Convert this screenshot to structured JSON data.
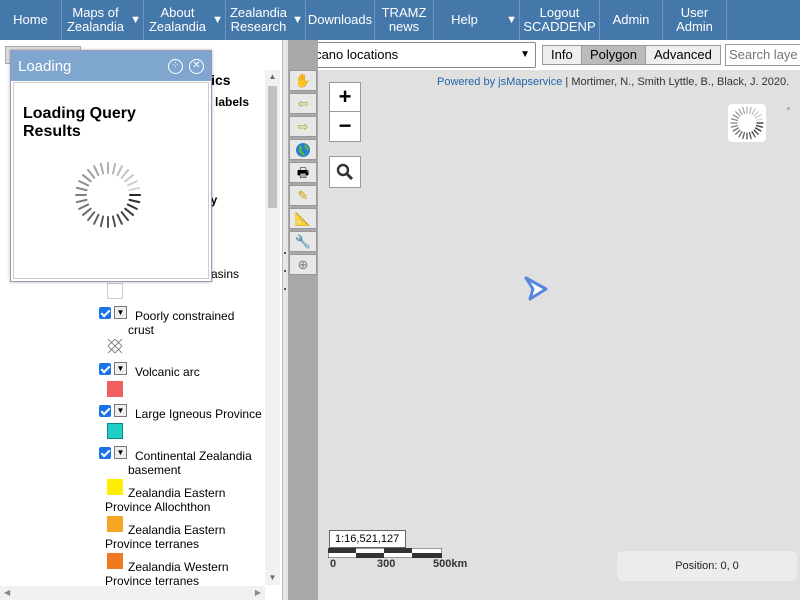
{
  "menu": {
    "items": [
      {
        "label": "Home",
        "dropdown": false
      },
      {
        "label": "Maps of Zealandia",
        "dropdown": true
      },
      {
        "label": "About Zealandia",
        "dropdown": true
      },
      {
        "label": "Zealandia Research",
        "dropdown": true
      },
      {
        "label": "Downloads",
        "dropdown": false
      },
      {
        "label": "TRAMZ news",
        "dropdown": false
      },
      {
        "label": "Help",
        "dropdown": true
      },
      {
        "label": "Logout SCADDENP",
        "dropdown": false
      },
      {
        "label": "Admin",
        "dropdown": false
      },
      {
        "label": "User Admin",
        "dropdown": false
      }
    ]
  },
  "loading_dialog": {
    "header": "Loading",
    "title": "Loading Query Results"
  },
  "layers": {
    "partial_header": "onics",
    "partial_labels": "labels",
    "partial_ogy": "ogy",
    "partial_slash": "/",
    "partial_basins": "asins",
    "items": [
      {
        "label": "Poorly constrained crust",
        "checked": true
      },
      {
        "label": "Volcanic arc",
        "checked": true,
        "color": "#f06060"
      },
      {
        "label": "Large Igneous Province",
        "checked": true,
        "color": "#1fcfc7"
      },
      {
        "label": "Continental Zealandia basement",
        "checked": true
      }
    ],
    "sublegend": [
      {
        "label": "Zealandia Eastern Province Allochthon",
        "color": "#ffee00"
      },
      {
        "label": "Zealandia Eastern Province terranes",
        "color": "#f5a623"
      },
      {
        "label": "Zealandia Western Province terranes",
        "color": "#f07a20"
      }
    ]
  },
  "map": {
    "layer_select": "Volcano locations",
    "tabs": [
      "Info",
      "Polygon",
      "Advanced"
    ],
    "active_tab": "Polygon",
    "search_placeholder": "Search laye",
    "attribution_link": "Powered by jsMapservice",
    "attribution_text": " | Mortimer, N., Smith Lyttle, B., Black, J. 2020.",
    "zoom_in": "+",
    "zoom_out": "−",
    "scale_ratio": "1:16,521,127",
    "scale_labels": [
      "0",
      "300",
      "500km"
    ],
    "position": "Position: 0, 0"
  }
}
